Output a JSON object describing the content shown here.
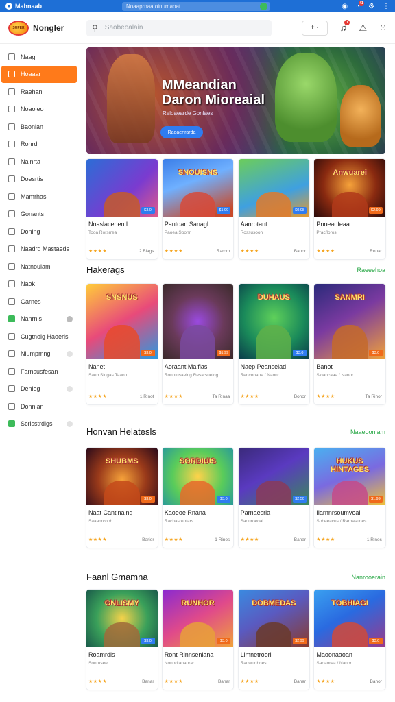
{
  "topbar": {
    "brand": "Mahnaab",
    "url": "Noaaprnaatoinumaoat",
    "notif_count": "41"
  },
  "header": {
    "logo_mark": "SUPER",
    "app_name": "Nongler",
    "search_placeholder": "Saobeoalain",
    "add_label": "+ ·"
  },
  "sidebar": {
    "items": [
      {
        "label": "Naag",
        "style": ""
      },
      {
        "label": "Hoaaar",
        "style": "active"
      },
      {
        "label": "Raehan",
        "style": ""
      },
      {
        "label": "Noaoleo",
        "style": ""
      },
      {
        "label": "Baonlan",
        "style": ""
      },
      {
        "label": "Ronrd",
        "style": ""
      },
      {
        "label": "Nainrta",
        "style": ""
      },
      {
        "label": "Doesrtis",
        "style": ""
      },
      {
        "label": "Mamrhas",
        "style": ""
      },
      {
        "label": "Gonants",
        "style": ""
      },
      {
        "label": "Doning",
        "style": ""
      },
      {
        "label": "Naadrd Mastaeds",
        "style": ""
      },
      {
        "label": "Natnoulam",
        "style": ""
      },
      {
        "label": "Naok",
        "style": ""
      },
      {
        "label": "Garnes",
        "style": ""
      },
      {
        "label": "Nanrnis",
        "style": "green",
        "tail": "dark"
      },
      {
        "label": "Cugtnoig Haoeris",
        "style": ""
      },
      {
        "label": "Niumpmng",
        "style": "",
        "tail": "light"
      },
      {
        "label": "Farnsusfesan",
        "style": ""
      },
      {
        "label": "Denlog",
        "style": "",
        "tail": "light"
      },
      {
        "label": "Donnlan",
        "style": ""
      },
      {
        "label": "Scrisstrdlgs",
        "style": "green",
        "tail": "light"
      }
    ]
  },
  "hero": {
    "title": "MMeandian Daron Mioreaial",
    "subtitle": "Reloaearde Gonlaes",
    "button": "Raoaenrarda"
  },
  "row1": [
    {
      "title": "",
      "name": "Nnaslacerientl",
      "sub": "Tooa Rorsrrea",
      "count": "2 Blags",
      "badge": "$3.0",
      "badgecolor": "#2e7cf0",
      "bg": "linear-gradient(135deg,#2c6dd6,#7a3bd0 60%,#e05a8a)",
      "blob": "#c45a2a"
    },
    {
      "title": "SNOUISNS",
      "name": "Pantoan Sanagl",
      "sub": "Paoea Soonr",
      "count": "Rarom",
      "badge": "$1.99",
      "badgecolor": "#2e7cf0",
      "bg": "linear-gradient(160deg,#3b7ee8,#6fb0ff 40%,#c84a2a 90%)",
      "blob": "#d64a3a"
    },
    {
      "title": "",
      "name": "Aanrotant",
      "sub": "Rossusoon",
      "count": "Banor",
      "badge": "$0.98",
      "badgecolor": "#2e7cf0",
      "bg": "linear-gradient(160deg,#6ccd5a,#3fa0e0 60%,#e89a2a)",
      "blob": "#e07a2a"
    },
    {
      "title": "Anwuarei",
      "name": "Pnneaofeaa",
      "sub": "Pracfloros",
      "count": "Ronar",
      "badge": "$2.99",
      "badgecolor": "#f06a1a",
      "bg": "radial-gradient(circle at 50% 45%,#f6a23a,#8a2a10 55%,#2a0a0a)",
      "blob": "#b03a1a"
    }
  ],
  "sec1": {
    "title": "Hakerags",
    "link": "Raeeehoa"
  },
  "row2": [
    {
      "title": "SNSNUS",
      "name": "Nanet",
      "sub": "Saeb Slogas Taaon",
      "count": "1 Rinot",
      "badge": "$3.0",
      "badgecolor": "#f06a1a",
      "bg": "linear-gradient(150deg,#ffcc3a,#e84a7a 50%,#2a9ae0)",
      "blob": "#e84a2a"
    },
    {
      "title": "",
      "name": "Aoraant Malfias",
      "sub": "Ronntusaelng Resarsuelng",
      "count": "Ta Rinaa",
      "badge": "$1.99",
      "badgecolor": "#f06a1a",
      "bg": "radial-gradient(circle at 50% 50%,#9a4ae0,#6a3a5a 50%,#3a2a2a)",
      "blob": "#7a4aa0"
    },
    {
      "title": "DUHAUS",
      "name": "Naep Peanseiad",
      "sub": "Renconane / Naonr",
      "count": "Bonor",
      "badge": "$3.0",
      "badgecolor": "#2e7cf0",
      "bg": "radial-gradient(circle at 50% 45%,#5fd05a,#1a8a5a 55%,#0a3a4a)",
      "blob": "#5fb04a"
    },
    {
      "title": "SANMRI",
      "name": "Banot",
      "sub": "Sloancaaa / Nanor",
      "count": "Ta Rinor",
      "badge": "$3.0",
      "badgecolor": "#f06a1a",
      "bg": "linear-gradient(150deg,#2a2a7a,#7a3aa0 45%,#f0a23a)",
      "blob": "#c46a2a"
    }
  ],
  "sec2": {
    "title": "Honvan Helatesls",
    "link": "Naaeoonlam"
  },
  "row3": [
    {
      "title": "SHUBMS",
      "name": "Naat Cantinaing",
      "sub": "Saaanrcoob",
      "count": "Barier",
      "badge": "$3.0",
      "badgecolor": "#f06a1a",
      "bg": "radial-gradient(circle at 50% 55%,#f6a23a,#9a3a1a 50%,#2a0a1a)",
      "blob": "#c44a1a"
    },
    {
      "title": "SORDIUIS",
      "name": "Kaoeoe Rnana",
      "sub": "Rachasreotars",
      "count": "1 Rinos",
      "badge": "$3.0",
      "badgecolor": "#2e7cf0",
      "bg": "radial-gradient(circle at 50% 50%,#ffd24a,#5acc5a 55%,#2a9a9a)",
      "blob": "#e86a2a"
    },
    {
      "title": "",
      "name": "Parnaesrla",
      "sub": "Saouroeoal",
      "count": "Banar",
      "badge": "$2.50",
      "badgecolor": "#2e7cf0",
      "bg": "linear-gradient(150deg,#3a2a7a,#5a3ac0 45%,#3a8a5a)",
      "blob": "#8a3a5a"
    },
    {
      "title": "HUKUS HINTAGES",
      "name": "Iiarnnrsoumveal",
      "sub": "Soheeacus / Rarhasunes",
      "count": "1 Rinos",
      "badge": "$1.99",
      "badgecolor": "#f06a1a",
      "bg": "linear-gradient(160deg,#4ab0f0,#7a6ae0 50%,#f0c23a)",
      "blob": "#c44a8a"
    }
  ],
  "sec3": {
    "title": "Faanl Gmamna",
    "link": "Nanrooerain"
  },
  "row4": [
    {
      "title": "GNLISMY",
      "name": "Roamrdis",
      "sub": "Sonrusee",
      "count": "Banar",
      "badge": "$3.0",
      "badgecolor": "#2e7cf0",
      "bg": "radial-gradient(circle at 50% 50%,#f6d24a,#3aa05a 55%,#1a5a4a)",
      "blob": "#a06a3a"
    },
    {
      "title": "RUNHOR",
      "name": "Ront Rinnseniana",
      "sub": "Nonodtanaorar",
      "count": "Banar",
      "badge": "$3.0",
      "badgecolor": "#f06a1a",
      "bg": "linear-gradient(150deg,#8a2ad0,#e04a8a 50%,#f0a23a)",
      "blob": "#e8a03a"
    },
    {
      "title": "DOBMEDAS",
      "name": "Limnetroorl",
      "sub": "Raowunhnes",
      "count": "Banar",
      "badge": "$2.99",
      "badgecolor": "#f06a1a",
      "bg": "linear-gradient(150deg,#3a8ae0,#5a5ac0 45%,#8a3a2a)",
      "blob": "#6a3a2a"
    },
    {
      "title": "TOBHIAGI",
      "name": "Maoonaaoan",
      "sub": "Sanaoraa / Nanor",
      "count": "Banor",
      "badge": "$3.0",
      "badgecolor": "#f06a1a",
      "bg": "linear-gradient(150deg,#3aa0f0,#2a6ae0 45%,#9a3a8a)",
      "blob": "#d04a3a"
    }
  ],
  "stars": "★★★★"
}
